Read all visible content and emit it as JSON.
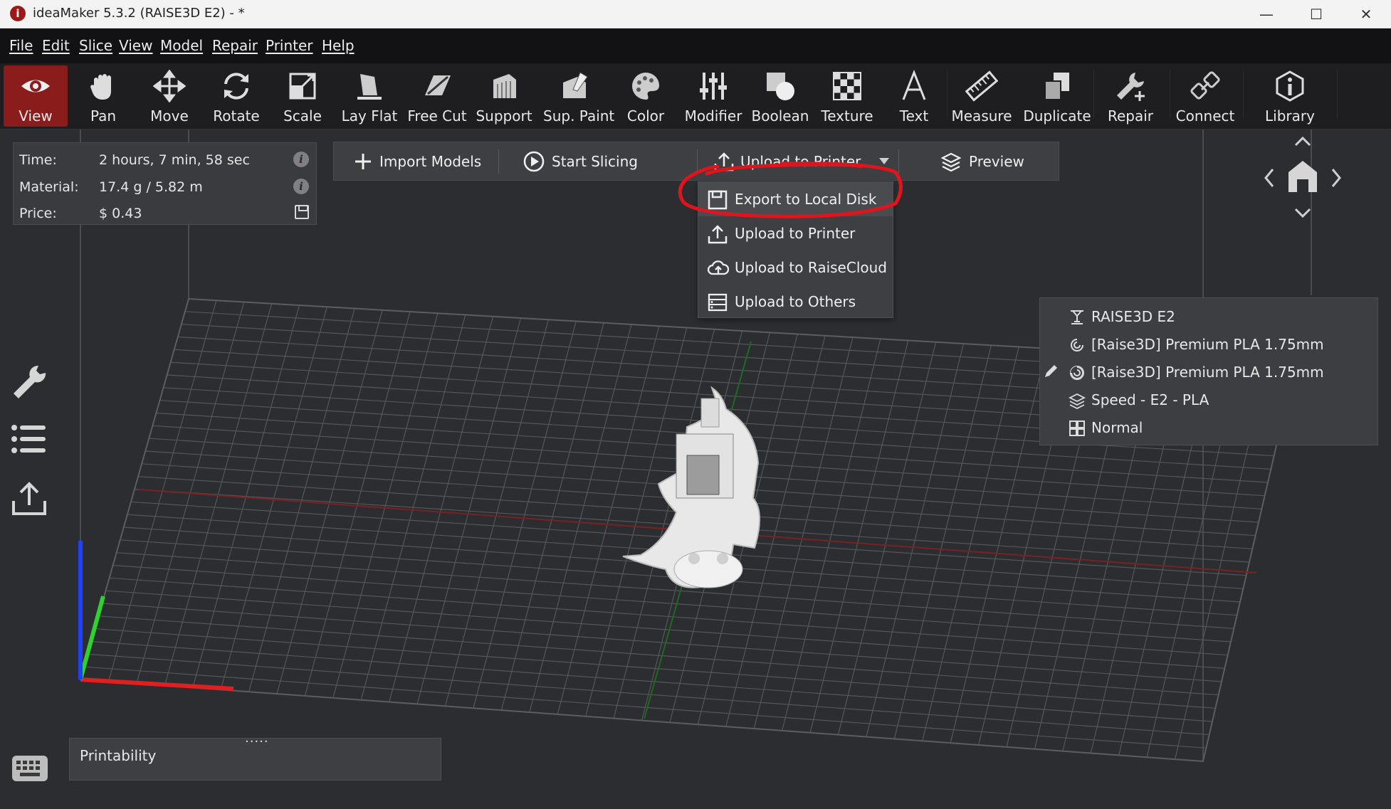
{
  "window": {
    "title": "ideaMaker 5.3.2 (RAISE3D E2) - *",
    "logo_glyph": "i",
    "minimize": "—",
    "maximize": "☐",
    "close": "✕"
  },
  "menubar": {
    "items": [
      "File",
      "Edit",
      "Slice",
      "View",
      "Model",
      "Repair",
      "Printer",
      "Help"
    ]
  },
  "toolbar": {
    "items": [
      {
        "label": "View",
        "icon": "eye-icon",
        "active": true
      },
      {
        "label": "Pan",
        "icon": "hand-icon"
      },
      {
        "label": "Move",
        "icon": "move-arrows-icon"
      },
      {
        "label": "Rotate",
        "icon": "rotate-icon"
      },
      {
        "label": "Scale",
        "icon": "scale-icon"
      },
      {
        "label": "Lay Flat",
        "icon": "lay-flat-icon"
      },
      {
        "label": "Free Cut",
        "icon": "free-cut-icon"
      },
      {
        "label": "Support",
        "icon": "support-icon"
      },
      {
        "label": "Sup. Paint",
        "icon": "support-paint-icon"
      },
      {
        "label": "Color",
        "icon": "palette-icon"
      },
      {
        "label": "Modifier",
        "icon": "modifier-sliders-icon"
      },
      {
        "label": "Boolean",
        "icon": "boolean-icon"
      },
      {
        "label": "Texture",
        "icon": "checker-texture-icon"
      },
      {
        "label": "Text",
        "icon": "text-a-icon"
      },
      {
        "label": "Measure",
        "icon": "ruler-icon"
      },
      {
        "label": "Duplicate",
        "icon": "duplicate-icon"
      },
      {
        "label": "Repair",
        "icon": "wrench-plus-icon"
      },
      {
        "label": "Connect",
        "icon": "connect-icon"
      },
      {
        "label": "Library",
        "icon": "library-info-icon"
      }
    ]
  },
  "info_panel": {
    "time_label": "Time:",
    "time_value": "2 hours, 7 min, 58 sec",
    "material_label": "Material:",
    "material_value": "17.4 g / 5.82 m",
    "price_label": "Price:",
    "price_value": "$ 0.43",
    "info_glyph": "i"
  },
  "action_bar": {
    "import": "Import Models",
    "slice": "Start Slicing",
    "upload": "Upload to Printer",
    "preview": "Preview"
  },
  "export_menu": {
    "items": [
      {
        "label": "Export to Local Disk",
        "icon": "save-disk-icon"
      },
      {
        "label": "Upload to Printer",
        "icon": "upload-icon"
      },
      {
        "label": "Upload to RaiseCloud",
        "icon": "cloud-upload-icon"
      },
      {
        "label": "Upload to Others",
        "icon": "server-icon"
      }
    ],
    "highlighted_index": 0
  },
  "profile_panel": {
    "items": [
      {
        "label": "RAISE3D E2",
        "icon": "printer-icon"
      },
      {
        "label": "[Raise3D] Premium PLA 1.75mm",
        "icon": "filament-left-icon"
      },
      {
        "label": "[Raise3D] Premium PLA 1.75mm",
        "icon": "filament-right-icon"
      },
      {
        "label": "Speed - E2 - PLA",
        "icon": "layers-icon"
      },
      {
        "label": "Normal",
        "icon": "grid-icon"
      }
    ]
  },
  "printability": {
    "label": "Printability",
    "grip": "·····"
  },
  "colors": {
    "accent_active": "#8b1c1c",
    "annotation": "#e0141c",
    "axis_x": "#e02020",
    "axis_y": "#30d030",
    "axis_z": "#2040ff"
  }
}
